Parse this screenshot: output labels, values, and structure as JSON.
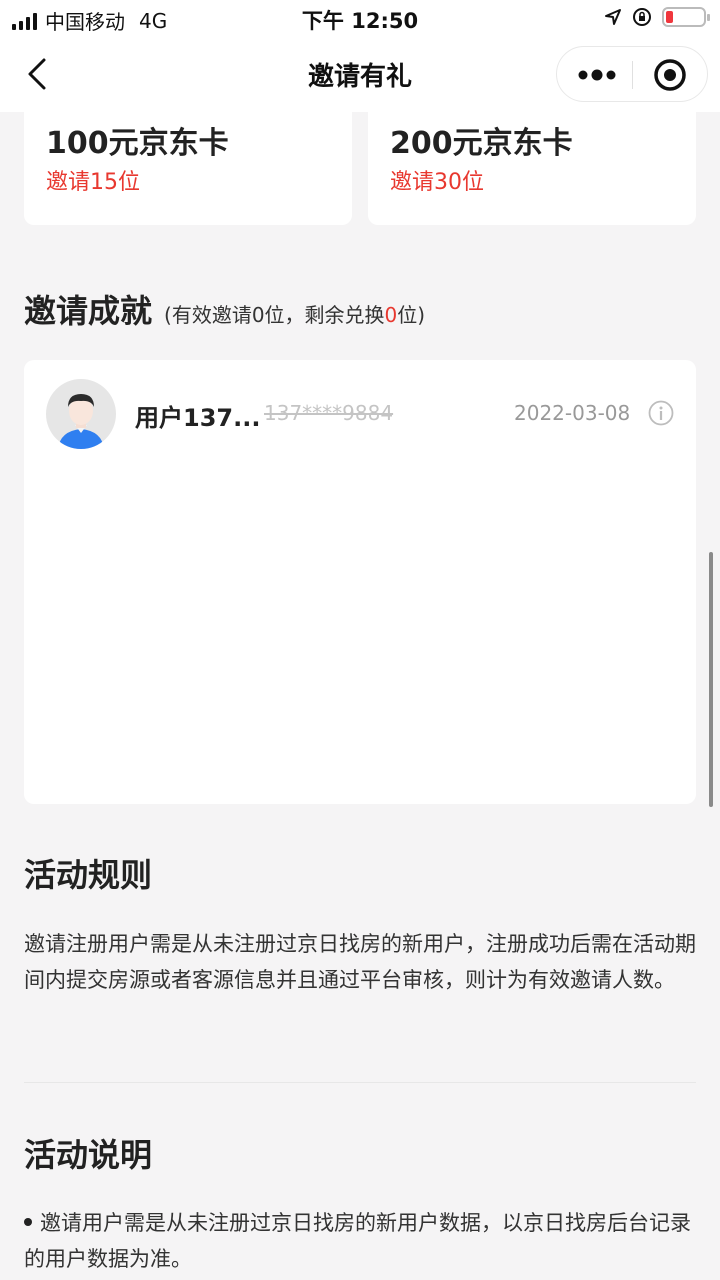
{
  "status_bar": {
    "carrier": "中国移动",
    "network": "4G",
    "time": "下午 12:50"
  },
  "nav": {
    "title": "邀请有礼",
    "back_icon": "chevron-left-icon",
    "more_icon": "more-dots-icon",
    "close_icon": "target-circle-icon"
  },
  "rewards": [
    {
      "name": "100元京东卡",
      "condition": "邀请15位"
    },
    {
      "name": "200元京东卡",
      "condition": "邀请30位"
    }
  ],
  "achievement": {
    "title": "邀请成就",
    "summary_prefix": "(有效邀请0位，剩余兑换",
    "remaining": "0",
    "summary_suffix": "位)"
  },
  "invitees": [
    {
      "name": "用户137...",
      "phone": "137****9884",
      "date": "2022-03-08"
    }
  ],
  "rules": {
    "title": "活动规则",
    "text": "邀请注册用户需是从未注册过京日找房的新用户，注册成功后需在活动期间内提交房源或者客源信息并且通过平台审核，则计为有效邀请人数。"
  },
  "description": {
    "title": "活动说明",
    "items": [
      "邀请用户需是从未注册过京日找房的新用户数据，以京日找房后台记录的用户数据为准。"
    ]
  },
  "colors": {
    "accent_red": "#e8382f",
    "background": "#f5f4f5",
    "avatar_shirt": "#2f7ff0"
  }
}
